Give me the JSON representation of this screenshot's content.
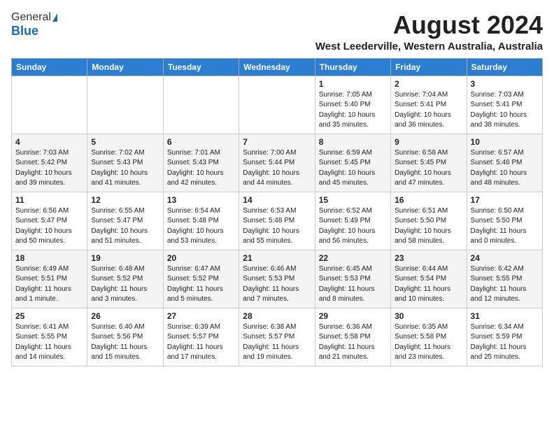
{
  "logo": {
    "general": "General",
    "blue": "Blue"
  },
  "title": "August 2024",
  "location": "West Leederville, Western Australia, Australia",
  "days_of_week": [
    "Sunday",
    "Monday",
    "Tuesday",
    "Wednesday",
    "Thursday",
    "Friday",
    "Saturday"
  ],
  "weeks": [
    [
      {
        "day": "",
        "info": ""
      },
      {
        "day": "",
        "info": ""
      },
      {
        "day": "",
        "info": ""
      },
      {
        "day": "",
        "info": ""
      },
      {
        "day": "1",
        "info": "Sunrise: 7:05 AM\nSunset: 5:40 PM\nDaylight: 10 hours\nand 35 minutes."
      },
      {
        "day": "2",
        "info": "Sunrise: 7:04 AM\nSunset: 5:41 PM\nDaylight: 10 hours\nand 36 minutes."
      },
      {
        "day": "3",
        "info": "Sunrise: 7:03 AM\nSunset: 5:41 PM\nDaylight: 10 hours\nand 38 minutes."
      }
    ],
    [
      {
        "day": "4",
        "info": "Sunrise: 7:03 AM\nSunset: 5:42 PM\nDaylight: 10 hours\nand 39 minutes."
      },
      {
        "day": "5",
        "info": "Sunrise: 7:02 AM\nSunset: 5:43 PM\nDaylight: 10 hours\nand 41 minutes."
      },
      {
        "day": "6",
        "info": "Sunrise: 7:01 AM\nSunset: 5:43 PM\nDaylight: 10 hours\nand 42 minutes."
      },
      {
        "day": "7",
        "info": "Sunrise: 7:00 AM\nSunset: 5:44 PM\nDaylight: 10 hours\nand 44 minutes."
      },
      {
        "day": "8",
        "info": "Sunrise: 6:59 AM\nSunset: 5:45 PM\nDaylight: 10 hours\nand 45 minutes."
      },
      {
        "day": "9",
        "info": "Sunrise: 6:58 AM\nSunset: 5:45 PM\nDaylight: 10 hours\nand 47 minutes."
      },
      {
        "day": "10",
        "info": "Sunrise: 6:57 AM\nSunset: 5:46 PM\nDaylight: 10 hours\nand 48 minutes."
      }
    ],
    [
      {
        "day": "11",
        "info": "Sunrise: 6:56 AM\nSunset: 5:47 PM\nDaylight: 10 hours\nand 50 minutes."
      },
      {
        "day": "12",
        "info": "Sunrise: 6:55 AM\nSunset: 5:47 PM\nDaylight: 10 hours\nand 51 minutes."
      },
      {
        "day": "13",
        "info": "Sunrise: 6:54 AM\nSunset: 5:48 PM\nDaylight: 10 hours\nand 53 minutes."
      },
      {
        "day": "14",
        "info": "Sunrise: 6:53 AM\nSunset: 5:48 PM\nDaylight: 10 hours\nand 55 minutes."
      },
      {
        "day": "15",
        "info": "Sunrise: 6:52 AM\nSunset: 5:49 PM\nDaylight: 10 hours\nand 56 minutes."
      },
      {
        "day": "16",
        "info": "Sunrise: 6:51 AM\nSunset: 5:50 PM\nDaylight: 10 hours\nand 58 minutes."
      },
      {
        "day": "17",
        "info": "Sunrise: 6:50 AM\nSunset: 5:50 PM\nDaylight: 11 hours\nand 0 minutes."
      }
    ],
    [
      {
        "day": "18",
        "info": "Sunrise: 6:49 AM\nSunset: 5:51 PM\nDaylight: 11 hours\nand 1 minute."
      },
      {
        "day": "19",
        "info": "Sunrise: 6:48 AM\nSunset: 5:52 PM\nDaylight: 11 hours\nand 3 minutes."
      },
      {
        "day": "20",
        "info": "Sunrise: 6:47 AM\nSunset: 5:52 PM\nDaylight: 11 hours\nand 5 minutes."
      },
      {
        "day": "21",
        "info": "Sunrise: 6:46 AM\nSunset: 5:53 PM\nDaylight: 11 hours\nand 7 minutes."
      },
      {
        "day": "22",
        "info": "Sunrise: 6:45 AM\nSunset: 5:53 PM\nDaylight: 11 hours\nand 8 minutes."
      },
      {
        "day": "23",
        "info": "Sunrise: 6:44 AM\nSunset: 5:54 PM\nDaylight: 11 hours\nand 10 minutes."
      },
      {
        "day": "24",
        "info": "Sunrise: 6:42 AM\nSunset: 5:55 PM\nDaylight: 11 hours\nand 12 minutes."
      }
    ],
    [
      {
        "day": "25",
        "info": "Sunrise: 6:41 AM\nSunset: 5:55 PM\nDaylight: 11 hours\nand 14 minutes."
      },
      {
        "day": "26",
        "info": "Sunrise: 6:40 AM\nSunset: 5:56 PM\nDaylight: 11 hours\nand 15 minutes."
      },
      {
        "day": "27",
        "info": "Sunrise: 6:39 AM\nSunset: 5:57 PM\nDaylight: 11 hours\nand 17 minutes."
      },
      {
        "day": "28",
        "info": "Sunrise: 6:38 AM\nSunset: 5:57 PM\nDaylight: 11 hours\nand 19 minutes."
      },
      {
        "day": "29",
        "info": "Sunrise: 6:36 AM\nSunset: 5:58 PM\nDaylight: 11 hours\nand 21 minutes."
      },
      {
        "day": "30",
        "info": "Sunrise: 6:35 AM\nSunset: 5:58 PM\nDaylight: 11 hours\nand 23 minutes."
      },
      {
        "day": "31",
        "info": "Sunrise: 6:34 AM\nSunset: 5:59 PM\nDaylight: 11 hours\nand 25 minutes."
      }
    ]
  ]
}
